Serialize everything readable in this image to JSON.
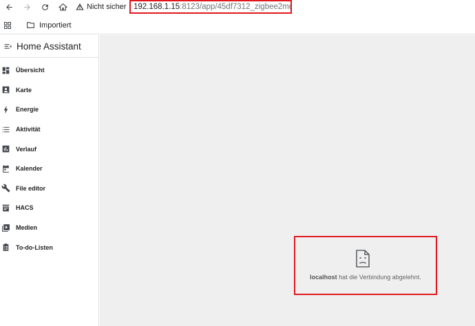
{
  "browser": {
    "security_label": "Nicht sicher",
    "url_host": "192.168.1.15",
    "url_rest": ":8123/app/45df7312_zigbee2mqtt",
    "bookmark_folder": "Importiert"
  },
  "sidebar": {
    "title": "Home Assistant",
    "items": [
      {
        "label": "Übersicht",
        "icon": "dashboard-icon"
      },
      {
        "label": "Karte",
        "icon": "map-icon"
      },
      {
        "label": "Energie",
        "icon": "lightning-bolt-icon"
      },
      {
        "label": "Aktivität",
        "icon": "list-icon"
      },
      {
        "label": "Verlauf",
        "icon": "chart-bar-icon"
      },
      {
        "label": "Kalender",
        "icon": "calendar-icon"
      },
      {
        "label": "File editor",
        "icon": "wrench-icon"
      },
      {
        "label": "HACS",
        "icon": "hacs-icon"
      },
      {
        "label": "Medien",
        "icon": "media-icon"
      },
      {
        "label": "To-do-Listen",
        "icon": "clipboard-list-icon"
      }
    ]
  },
  "error": {
    "host": "localhost",
    "message": "hat die Verbindung abgelehnt."
  },
  "colors": {
    "highlight_border": "#e0161c",
    "main_background": "#efefef"
  }
}
